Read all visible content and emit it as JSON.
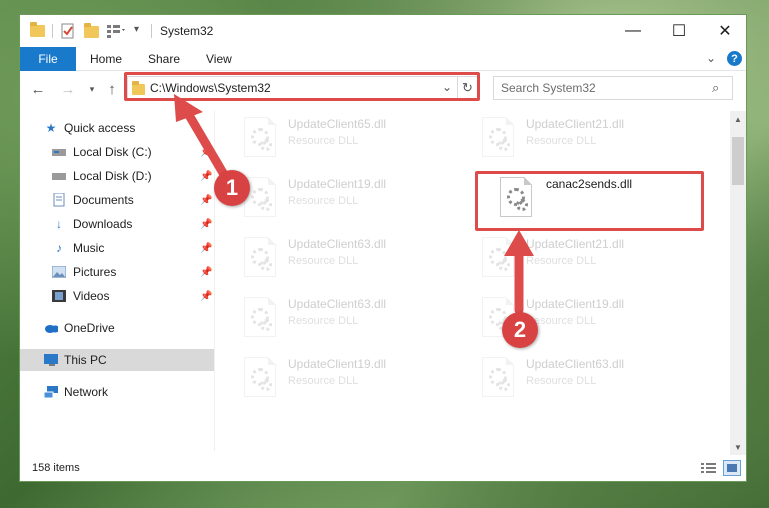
{
  "window": {
    "title": "System32",
    "controls": {
      "minimize": "—",
      "maximize": "☐",
      "close": "✕"
    }
  },
  "ribbon": {
    "tabs": [
      "File",
      "Home",
      "Share",
      "View"
    ],
    "expand_icon": "chevron-down-icon",
    "help_icon": "help-icon"
  },
  "nav": {
    "address": "C:\\Windows\\System32",
    "search_placeholder": "Search System32"
  },
  "sidebar": {
    "items": [
      {
        "label": "Quick access",
        "icon": "star-icon",
        "pinned": false
      },
      {
        "label": "Local Disk (C:)",
        "icon": "drive-icon",
        "pinned": true
      },
      {
        "label": "Local Disk (D:)",
        "icon": "drive-icon",
        "pinned": true
      },
      {
        "label": "Documents",
        "icon": "documents-icon",
        "pinned": true
      },
      {
        "label": "Downloads",
        "icon": "download-icon",
        "pinned": true
      },
      {
        "label": "Music",
        "icon": "music-icon",
        "pinned": true
      },
      {
        "label": "Pictures",
        "icon": "pictures-icon",
        "pinned": true
      },
      {
        "label": "Videos",
        "icon": "videos-icon",
        "pinned": true
      },
      {
        "label": "OneDrive",
        "icon": "cloud-icon",
        "pinned": false
      },
      {
        "label": "This PC",
        "icon": "computer-icon",
        "pinned": false,
        "selected": true
      },
      {
        "label": "Network",
        "icon": "network-icon",
        "pinned": false
      }
    ]
  },
  "files": {
    "type_label": "Resource DLL",
    "items": [
      {
        "name": "UpdateClient65.dll",
        "faded": true
      },
      {
        "name": "UpdateClient21.dll",
        "faded": true
      },
      {
        "name": "UpdateClient19.dll",
        "faded": true
      },
      {
        "name": "canac2sends.dll",
        "faded": false
      },
      {
        "name": "UpdateClient63.dll",
        "faded": true
      },
      {
        "name": "UpdateClient21.dll",
        "faded": true
      },
      {
        "name": "UpdateClient63.dll",
        "faded": true
      },
      {
        "name": "UpdateClient19.dll",
        "faded": true
      },
      {
        "name": "UpdateClient19.dll",
        "faded": true
      },
      {
        "name": "UpdateClient63.dll",
        "faded": true
      }
    ]
  },
  "status": {
    "item_count": "158 items"
  },
  "annotations": {
    "color": "#dd4b4b",
    "badges": [
      "1",
      "2"
    ]
  },
  "colors": {
    "file_tab": "#1979ca",
    "selection": "#d9d9d9"
  }
}
